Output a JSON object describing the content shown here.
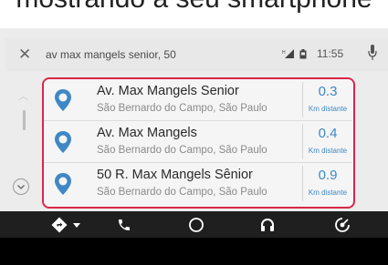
{
  "top_text": "mostrando a seu smartphone",
  "search": {
    "query": "av max mangels senior, 50"
  },
  "status": {
    "time": "11:55"
  },
  "colors": {
    "accent": "#3f88c5",
    "highlight_border": "#d9264a",
    "pin": "#3f88c5"
  },
  "results": [
    {
      "name": "Av. Max Mangels Senior",
      "address": "São Bernardo do Campo, São Paulo",
      "distance": "0.3",
      "unit": "Km distante"
    },
    {
      "name": "Av. Max Mangels",
      "address": "São Bernardo do Campo, São Paulo",
      "distance": "0.4",
      "unit": "Km distante"
    },
    {
      "name": "50 R. Max Mangels Sênior",
      "address": "São Bernardo do Campo, São Paulo",
      "distance": "0.9",
      "unit": "Km distante"
    }
  ],
  "nav": {
    "icons": [
      "navigation-icon",
      "phone-icon",
      "home-icon",
      "audio-icon",
      "exit-icon"
    ]
  }
}
